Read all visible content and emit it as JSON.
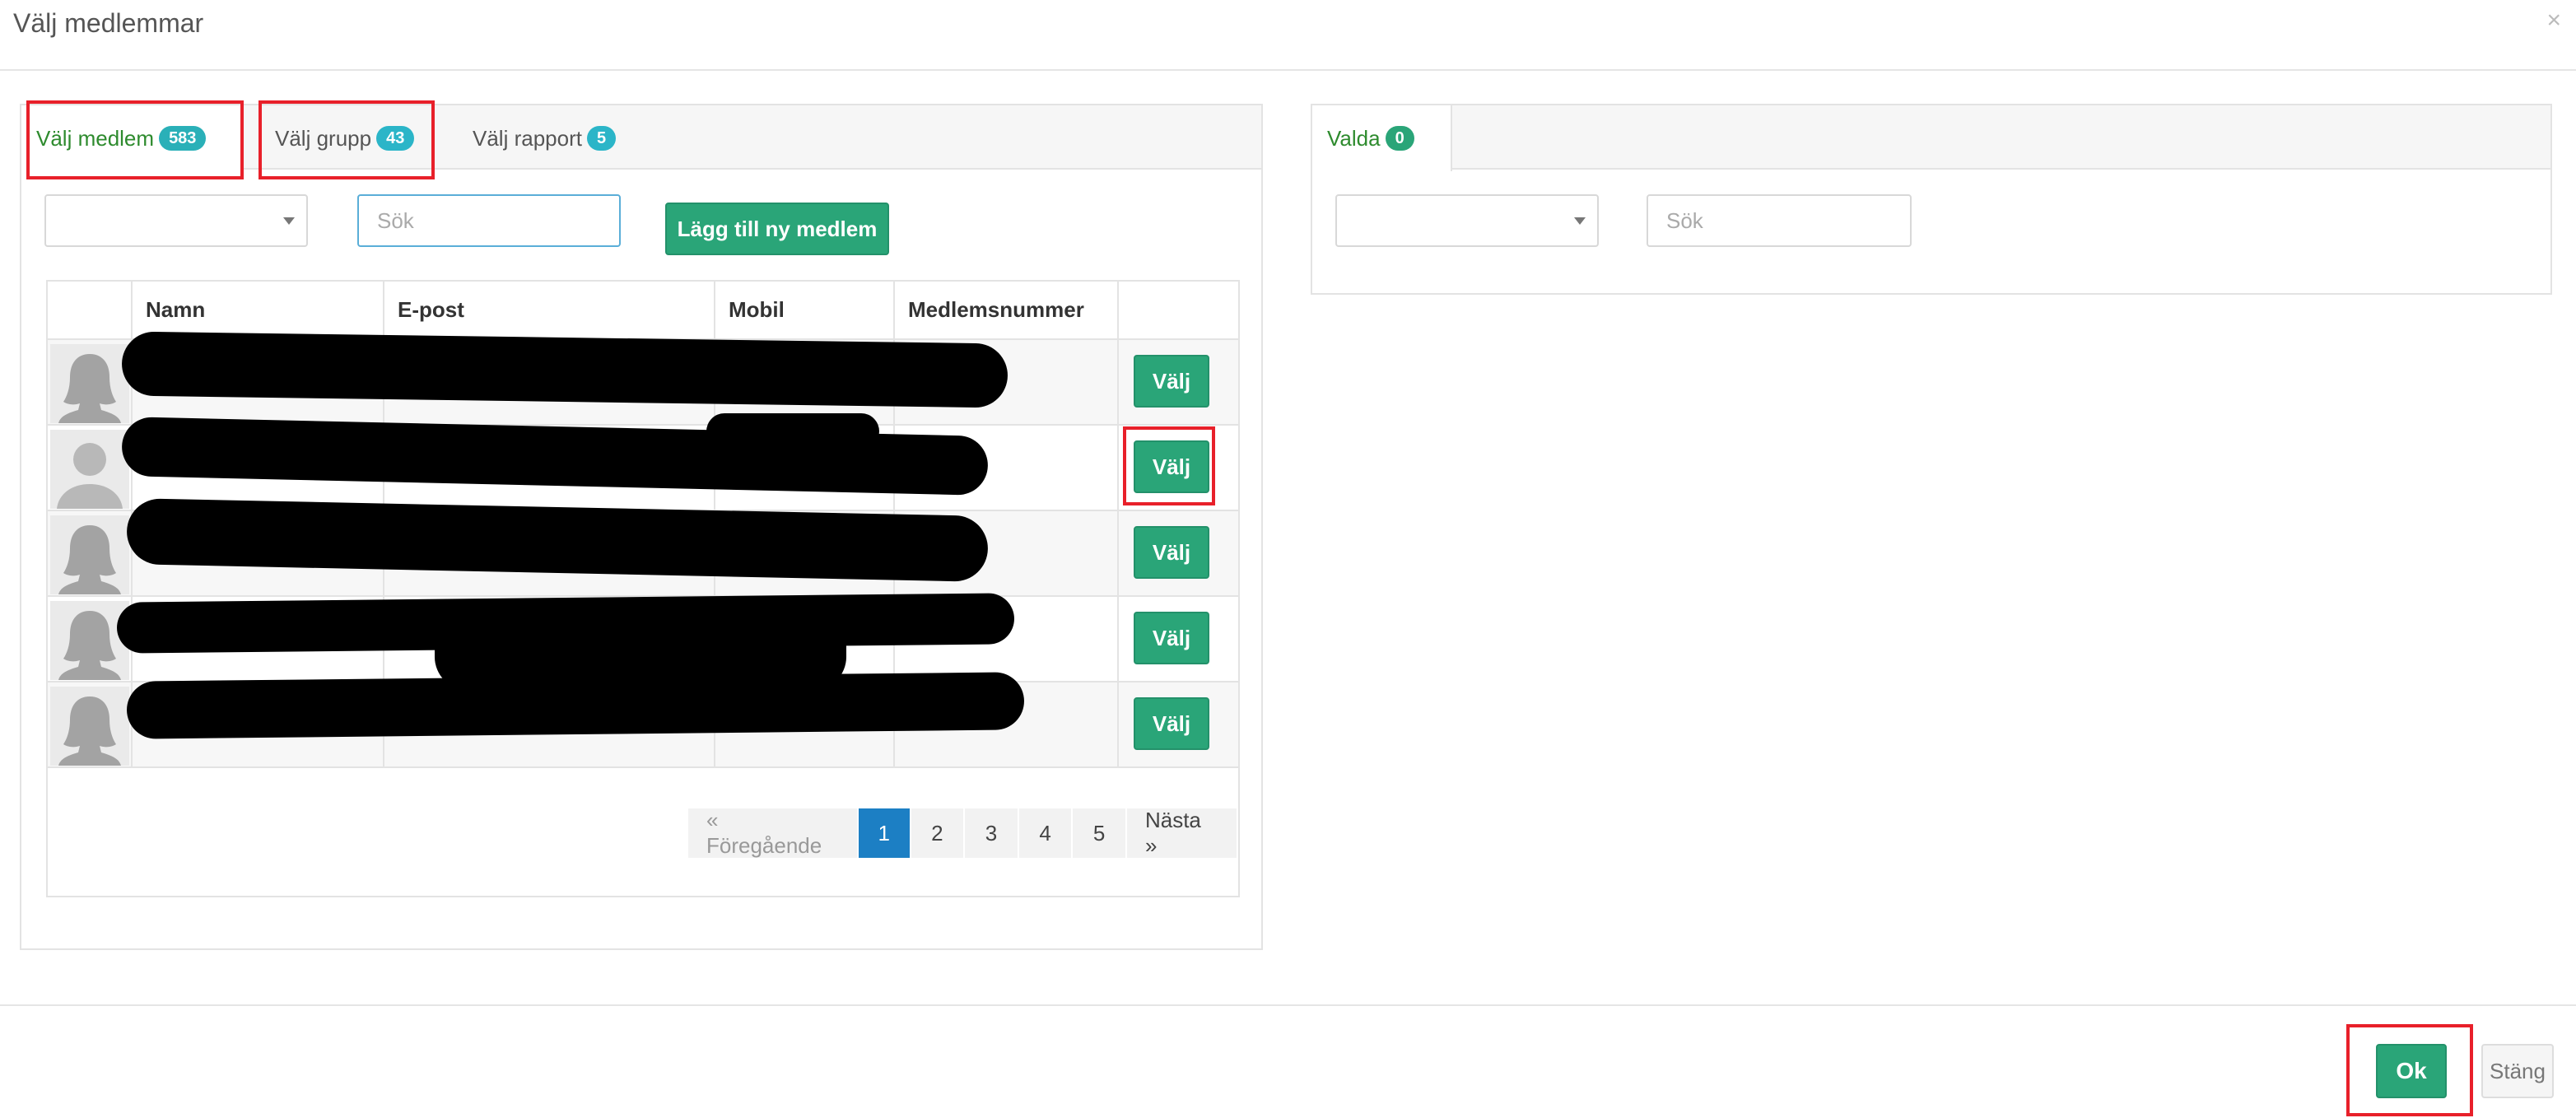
{
  "modal": {
    "title": "Välj medlemmar",
    "close_symbol": "×"
  },
  "tabs": [
    {
      "label": "Välj medlem",
      "count": "583"
    },
    {
      "label": "Välj grupp",
      "count": "43"
    },
    {
      "label": "Välj rapport",
      "count": "5"
    }
  ],
  "left_filters": {
    "select_value": "",
    "search_placeholder": "Sök",
    "add_button": "Lägg till ny medlem"
  },
  "table": {
    "headers": [
      "",
      "Namn",
      "E-post",
      "Mobil",
      "Medlemsnummer",
      ""
    ],
    "rows": [
      {
        "avatar": "female",
        "action": "Välj"
      },
      {
        "avatar": "male",
        "action": "Välj"
      },
      {
        "avatar": "female",
        "action": "Välj"
      },
      {
        "avatar": "female",
        "action": "Välj"
      },
      {
        "avatar": "female",
        "action": "Välj"
      }
    ]
  },
  "pagination": {
    "prev": "« Föregående",
    "pages": [
      "1",
      "2",
      "3",
      "4",
      "5"
    ],
    "current": "1",
    "next": "Nästa »"
  },
  "right_panel": {
    "tab_label": "Valda",
    "tab_count": "0",
    "select_value": "",
    "search_placeholder": "Sök"
  },
  "footer": {
    "ok": "Ok",
    "close": "Stäng"
  },
  "colors": {
    "primary_green": "#2aa578",
    "badge_cyan": "#2bb5c8",
    "active_page_blue": "#1c7fc4",
    "highlight_red": "#e8202a"
  }
}
